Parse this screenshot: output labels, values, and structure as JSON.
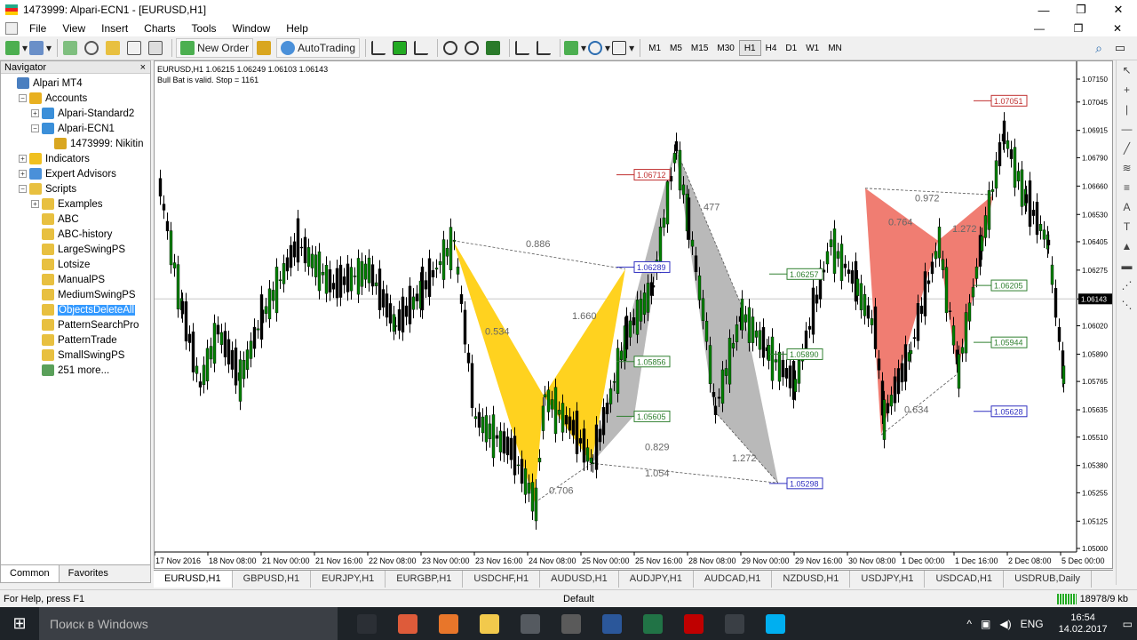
{
  "window": {
    "title": "1473999: Alpari-ECN1 - [EURUSD,H1]",
    "min": "—",
    "restore": "❐",
    "close": "✕"
  },
  "menu": [
    "File",
    "View",
    "Insert",
    "Charts",
    "Tools",
    "Window",
    "Help"
  ],
  "menu_right": {
    "min": "—",
    "restore": "❐",
    "close": "✕"
  },
  "toolbar": {
    "new_order": "New Order",
    "autotrading": "AutoTrading",
    "timeframes": [
      "M1",
      "M5",
      "M15",
      "M30",
      "H1",
      "H4",
      "D1",
      "W1",
      "MN"
    ],
    "active_tf": "H1"
  },
  "navigator": {
    "title": "Navigator",
    "close": "×",
    "tabs": [
      "Common",
      "Favorites"
    ],
    "tree": [
      {
        "label": "Alpari MT4",
        "level": 0,
        "exp": "",
        "icon": "terminal-icon",
        "color": "#4a7fc0"
      },
      {
        "label": "Accounts",
        "level": 1,
        "exp": "−",
        "icon": "accounts-icon",
        "color": "#e8b020"
      },
      {
        "label": "Alpari-Standard2",
        "level": 2,
        "exp": "+",
        "icon": "server-icon",
        "color": "#3b8fd9"
      },
      {
        "label": "Alpari-ECN1",
        "level": 2,
        "exp": "−",
        "icon": "server-icon",
        "color": "#3b8fd9"
      },
      {
        "label": "1473999: Nikitin",
        "level": 3,
        "exp": "",
        "icon": "user-icon",
        "color": "#d9a620"
      },
      {
        "label": "Indicators",
        "level": 1,
        "exp": "+",
        "icon": "indicators-icon",
        "color": "#f0c020"
      },
      {
        "label": "Expert Advisors",
        "level": 1,
        "exp": "+",
        "icon": "experts-icon",
        "color": "#4a90d9"
      },
      {
        "label": "Scripts",
        "level": 1,
        "exp": "−",
        "icon": "scripts-icon",
        "color": "#e8c040"
      },
      {
        "label": "Examples",
        "level": 2,
        "exp": "+",
        "icon": "folder-icon",
        "color": "#e8c040"
      },
      {
        "label": "ABC",
        "level": 2,
        "exp": "",
        "icon": "script-icon",
        "color": "#e8c040"
      },
      {
        "label": "ABC-history",
        "level": 2,
        "exp": "",
        "icon": "script-icon",
        "color": "#e8c040"
      },
      {
        "label": "LargeSwingPS",
        "level": 2,
        "exp": "",
        "icon": "script-icon",
        "color": "#e8c040"
      },
      {
        "label": "Lotsize",
        "level": 2,
        "exp": "",
        "icon": "script-icon",
        "color": "#e8c040"
      },
      {
        "label": "ManualPS",
        "level": 2,
        "exp": "",
        "icon": "script-icon",
        "color": "#e8c040"
      },
      {
        "label": "MediumSwingPS",
        "level": 2,
        "exp": "",
        "icon": "script-icon",
        "color": "#e8c040"
      },
      {
        "label": "ObjectsDeleteAll",
        "level": 2,
        "exp": "",
        "icon": "script-icon",
        "color": "#e8c040",
        "selected": true
      },
      {
        "label": "PatternSearchPro",
        "level": 2,
        "exp": "",
        "icon": "script-icon",
        "color": "#e8c040"
      },
      {
        "label": "PatternTrade",
        "level": 2,
        "exp": "",
        "icon": "script-icon",
        "color": "#e8c040"
      },
      {
        "label": "SmallSwingPS",
        "level": 2,
        "exp": "",
        "icon": "script-icon",
        "color": "#e8c040"
      },
      {
        "label": "251 more...",
        "level": 2,
        "exp": "",
        "icon": "globe-icon",
        "color": "#5aa05a"
      }
    ]
  },
  "chart": {
    "info_line1": "EURUSD,H1  1.06215 1.06249 1.06103 1.06143",
    "info_line2": "Bull Bat is valid. Stop = 1161",
    "current_price": "1.06143",
    "y_ticks": [
      "1.07150",
      "1.07045",
      "1.06915",
      "1.06790",
      "1.06660",
      "1.06530",
      "1.06405",
      "1.06275",
      "1.06143",
      "1.06020",
      "1.05890",
      "1.05765",
      "1.05635",
      "1.05510",
      "1.05380",
      "1.05255",
      "1.05125",
      "1.05000"
    ],
    "x_ticks": [
      "17 Nov 2016",
      "18 Nov 08:00",
      "21 Nov 00:00",
      "21 Nov 16:00",
      "22 Nov 08:00",
      "23 Nov 00:00",
      "23 Nov 16:00",
      "24 Nov 08:00",
      "25 Nov 00:00",
      "25 Nov 16:00",
      "28 Nov 08:00",
      "29 Nov 00:00",
      "29 Nov 16:00",
      "30 Nov 08:00",
      "1 Dec 00:00",
      "1 Dec 16:00",
      "2 Dec 08:00",
      "5 Dec 00:00"
    ],
    "price_labels": [
      {
        "text": "1.07051",
        "color": "#c03030"
      },
      {
        "text": "1.06712",
        "color": "#c03030"
      },
      {
        "text": "1.06289",
        "color": "#3030c0"
      },
      {
        "text": "1.05628",
        "color": "#3030c0"
      },
      {
        "text": "1.06257",
        "color": "#308030"
      },
      {
        "text": "1.06205",
        "color": "#308030"
      },
      {
        "text": "1.05944",
        "color": "#308030"
      },
      {
        "text": "1.05890",
        "color": "#308030"
      },
      {
        "text": "1.05856",
        "color": "#308030"
      },
      {
        "text": "1.05605",
        "color": "#308030"
      },
      {
        "text": "1.05298",
        "color": "#3030c0"
      }
    ],
    "ratios": [
      "0.886",
      "0.534",
      "1.660",
      "0.706",
      "0.829",
      "1.054",
      "1.272",
      "477",
      "0.972",
      "0.764",
      "1.272",
      "0.634"
    ]
  },
  "chart_tabs": [
    "EURUSD,H1",
    "GBPUSD,H1",
    "EURJPY,H1",
    "EURGBP,H1",
    "USDCHF,H1",
    "AUDUSD,H1",
    "AUDJPY,H1",
    "AUDCAD,H1",
    "NZDUSD,H1",
    "USDJPY,H1",
    "USDCAD,H1",
    "USDRUB,Daily"
  ],
  "status": {
    "help": "For Help, press F1",
    "profile": "Default",
    "traffic": "18978/9 kb"
  },
  "taskbar": {
    "search": "Поиск в Windows",
    "lang": "ENG",
    "time": "16:54",
    "date": "14.02.2017",
    "apps": [
      {
        "name": "task-view-icon",
        "color": "#2b2f35"
      },
      {
        "name": "chrome-icon",
        "color": "#de5b3a"
      },
      {
        "name": "orange-app-icon",
        "color": "#e8762a"
      },
      {
        "name": "file-explorer-icon",
        "color": "#f2c94c"
      },
      {
        "name": "calculator-icon",
        "color": "#555a60"
      },
      {
        "name": "alpari-icon",
        "color": "#5a5a5a"
      },
      {
        "name": "word-icon",
        "color": "#2b579a"
      },
      {
        "name": "excel-icon",
        "color": "#217346"
      },
      {
        "name": "filezilla-icon",
        "color": "#bf0000"
      },
      {
        "name": "clock-app-icon",
        "color": "#3a3f45"
      },
      {
        "name": "skype-icon",
        "color": "#00aff0"
      }
    ]
  },
  "colors": {
    "bat_yellow": "#ffd21f",
    "gray_pattern": "#b9b9b9",
    "salmon": "#f07d72",
    "candle": "#000000",
    "bull_body": "#008000"
  }
}
